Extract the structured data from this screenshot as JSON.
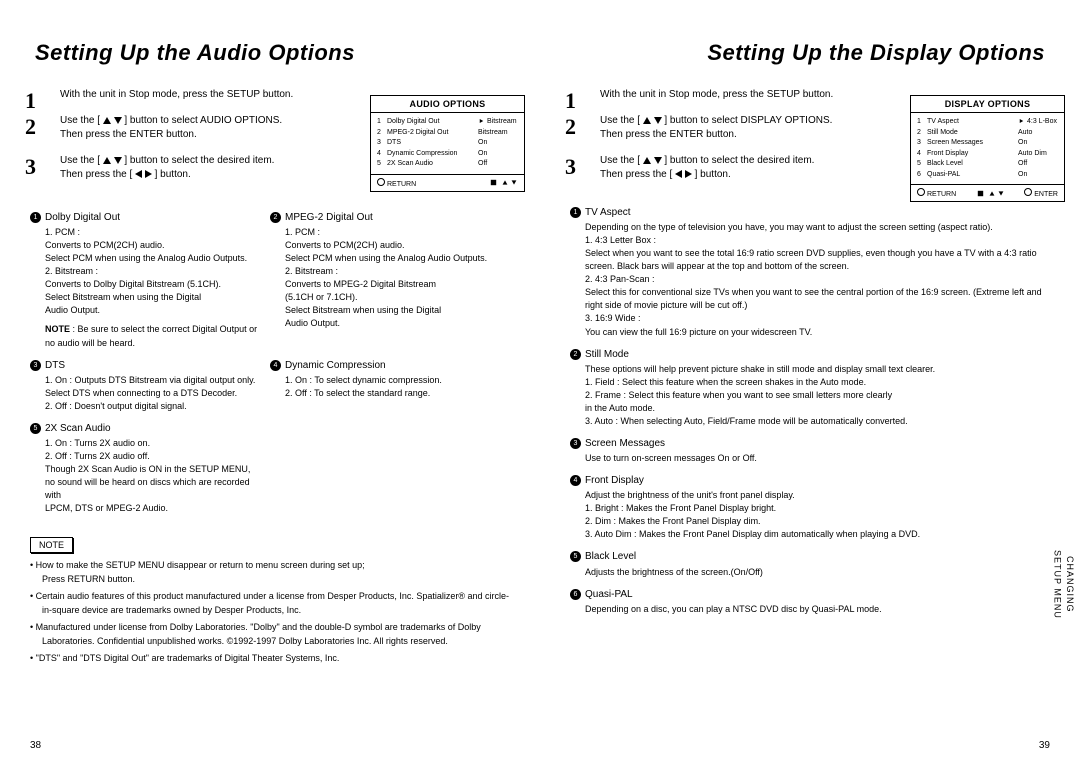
{
  "left": {
    "title": "Setting Up the Audio Options",
    "steps": {
      "s1": "With the unit in Stop mode, press the SETUP button.",
      "s2a": "Use the [",
      "s2b": "] button to select AUDIO OPTIONS.",
      "s2c": "Then press the ENTER button.",
      "s3a": "Use the [",
      "s3b": "] button to select the desired item.",
      "s3c": "Then press the [",
      "s3d": "] button."
    },
    "osd": {
      "header": "AUDIO OPTIONS",
      "rows": [
        {
          "n": "1",
          "l": "Dolby Digital Out",
          "v": "Bitstream",
          "sel": true
        },
        {
          "n": "2",
          "l": "MPEG-2 Digital Out",
          "v": "Bitstream"
        },
        {
          "n": "3",
          "l": "DTS",
          "v": "On"
        },
        {
          "n": "4",
          "l": "Dynamic Compression",
          "v": "On"
        },
        {
          "n": "5",
          "l": "2X Scan Audio",
          "v": "Off"
        }
      ],
      "ret": "RETURN"
    },
    "det": {
      "d1h": "Dolby Digital Out",
      "d1": "1. PCM :\nConverts to PCM(2CH) audio.\nSelect PCM when using the Analog Audio Outputs.\n2. Bitstream :\nConverts to Dolby Digital Bitstream (5.1CH).\nSelect Bitstream when using the Digital\nAudio Output.",
      "d1note": " : Be sure to select the correct Digital Output or no audio will be heard.",
      "d2h": "MPEG-2 Digital Out",
      "d2": "1. PCM :\nConverts to PCM(2CH) audio.\nSelect PCM when using the Analog Audio Outputs.\n2. Bitstream :\nConverts to MPEG-2 Digital Bitstream\n(5.1CH or 7.1CH).\nSelect Bitstream when using the Digital\nAudio Output.",
      "d3h": "DTS",
      "d3": "1. On : Outputs DTS Bitstream via digital output only.\n   Select DTS when connecting to a DTS Decoder.\n2. Off : Doesn't output digital signal.",
      "d4h": "Dynamic Compression",
      "d4": "1. On : To select dynamic compression.\n2. Off : To select the standard range.",
      "d5h": "2X Scan Audio",
      "d5": "1. On : Turns 2X audio on.\n2. Off : Turns 2X audio off.\nThough 2X Scan Audio is ON in the SETUP MENU,\nno sound will be heard on discs which are recorded with\nLPCM, DTS or MPEG-2 Audio."
    },
    "noteLabel": "NOTE",
    "notes": [
      "How to make the SETUP MENU disappear or return to menu screen during set up;\nPress RETURN button.",
      "Certain audio features of this product manufactured under a license from Desper Products, Inc. Spatializer® and circle-in-square device are trademarks owned by Desper Products, Inc.",
      "Manufactured under license from Dolby Laboratories. \"Dolby\" and the double-D symbol are trademarks of Dolby Laboratories. Confidential unpublished works. ©1992-1997 Dolby Laboratories Inc. All rights reserved.",
      "\"DTS\" and \"DTS Digital Out\" are trademarks of Digital Theater Systems, Inc."
    ],
    "page": "38"
  },
  "right": {
    "title": "Setting Up the Display Options",
    "steps": {
      "s1": "With the unit in Stop mode, press the SETUP button.",
      "s2a": "Use the [",
      "s2b": "] button to select DISPLAY OPTIONS.",
      "s2c": "Then press the ENTER button.",
      "s3a": "Use the [",
      "s3b": "] button to select the desired item.",
      "s3c": "Then press the [",
      "s3d": "] button."
    },
    "osd": {
      "header": "DISPLAY OPTIONS",
      "rows": [
        {
          "n": "1",
          "l": "TV Aspect",
          "v": "4:3 L-Box",
          "sel": true
        },
        {
          "n": "2",
          "l": "Still Mode",
          "v": "Auto"
        },
        {
          "n": "3",
          "l": "Screen Messages",
          "v": "On"
        },
        {
          "n": "4",
          "l": "Front Display",
          "v": "Auto Dim"
        },
        {
          "n": "5",
          "l": "Black Level",
          "v": "Off"
        },
        {
          "n": "6",
          "l": "Quasi-PAL",
          "v": "On"
        }
      ],
      "ret": "RETURN",
      "enter": "ENTER"
    },
    "det": {
      "d1h": "TV Aspect",
      "d1": "Depending on the type of television you have, you may want to adjust the screen setting (aspect ratio).\n1. 4:3 Letter Box :\nSelect when you want to see the total 16:9 ratio screen DVD supplies, even though you have a TV with a 4:3 ratio screen. Black bars will appear at the top and bottom of the screen.\n2. 4:3 Pan-Scan :\nSelect this for conventional size TVs when you want to see the central portion of the 16:9 screen. (Extreme left and right side of movie picture will be cut off.)\n3. 16:9 Wide :\nYou can view the full 16:9 picture on your widescreen TV.",
      "d2h": "Still Mode",
      "d2": "These options will help prevent picture shake in still mode and display small text clearer.\n1. Field : Select this feature when the screen shakes in the Auto mode.\n2. Frame : Select this feature when you want to see small letters more clearly\n            in the Auto mode.\n3. Auto : When selecting Auto, Field/Frame mode will be automatically converted.",
      "d3h": "Screen Messages",
      "d3": "Use to turn on-screen messages On or Off.",
      "d4h": "Front Display",
      "d4": "Adjust the brightness of the unit's front panel display.\n1. Bright : Makes the Front Panel Display bright.\n2. Dim : Makes the Front Panel Display dim.\n3. Auto Dim : Makes the Front Panel Display dim automatically when playing a DVD.",
      "d5h": "Black Level",
      "d5": "Adjusts the brightness of the screen.(On/Off)",
      "d6h": "Quasi-PAL",
      "d6": "Depending on a disc, you can play a NTSC DVD disc by Quasi-PAL mode."
    },
    "sidetab": "CHANGING\nSETUP MENU",
    "page": "39"
  }
}
